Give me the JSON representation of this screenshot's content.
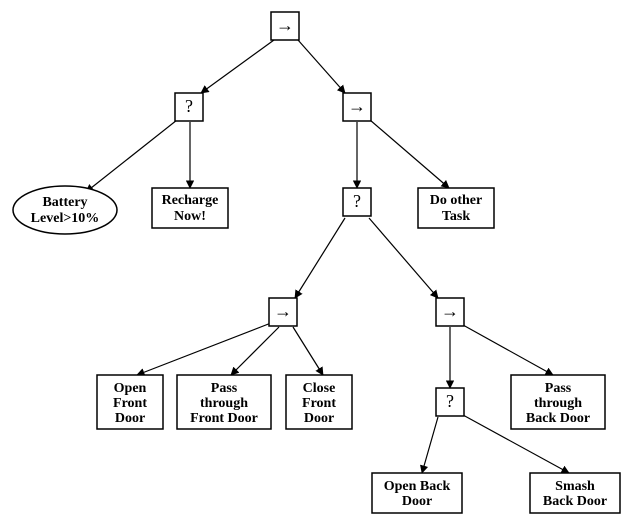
{
  "diagram": {
    "type": "behavior-tree",
    "symbols": {
      "sequence": "→",
      "fallback": "?"
    },
    "nodes": {
      "root": {
        "kind": "sequence",
        "label": "→"
      },
      "l1_fallback": {
        "kind": "fallback",
        "label": "?"
      },
      "l1_sequence": {
        "kind": "sequence",
        "label": "→"
      },
      "battery": {
        "kind": "condition",
        "label_lines": [
          "Battery",
          "Level>10%"
        ]
      },
      "recharge": {
        "kind": "action",
        "label_lines": [
          "Recharge",
          "Now!"
        ]
      },
      "mid_fallback": {
        "kind": "fallback",
        "label": "?"
      },
      "do_other": {
        "kind": "action",
        "label_lines": [
          "Do other",
          "Task"
        ]
      },
      "front_seq": {
        "kind": "sequence",
        "label": "→"
      },
      "back_seq": {
        "kind": "sequence",
        "label": "→"
      },
      "open_front": {
        "kind": "action",
        "label_lines": [
          "Open",
          "Front",
          "Door"
        ]
      },
      "pass_front": {
        "kind": "action",
        "label_lines": [
          "Pass",
          "through",
          "Front Door"
        ]
      },
      "close_front": {
        "kind": "action",
        "label_lines": [
          "Close",
          "Front",
          "Door"
        ]
      },
      "back_fallback": {
        "kind": "fallback",
        "label": "?"
      },
      "pass_back": {
        "kind": "action",
        "label_lines": [
          "Pass",
          "through",
          "Back Door"
        ]
      },
      "open_back": {
        "kind": "action",
        "label_lines": [
          "Open Back",
          "Door"
        ]
      },
      "smash_back": {
        "kind": "action",
        "label_lines": [
          "Smash",
          "Back Door"
        ]
      }
    },
    "edges": [
      [
        "root",
        "l1_fallback"
      ],
      [
        "root",
        "l1_sequence"
      ],
      [
        "l1_fallback",
        "battery"
      ],
      [
        "l1_fallback",
        "recharge"
      ],
      [
        "l1_sequence",
        "mid_fallback"
      ],
      [
        "l1_sequence",
        "do_other"
      ],
      [
        "mid_fallback",
        "front_seq"
      ],
      [
        "mid_fallback",
        "back_seq"
      ],
      [
        "front_seq",
        "open_front"
      ],
      [
        "front_seq",
        "pass_front"
      ],
      [
        "front_seq",
        "close_front"
      ],
      [
        "back_seq",
        "back_fallback"
      ],
      [
        "back_seq",
        "pass_back"
      ],
      [
        "back_fallback",
        "open_back"
      ],
      [
        "back_fallback",
        "smash_back"
      ]
    ]
  }
}
